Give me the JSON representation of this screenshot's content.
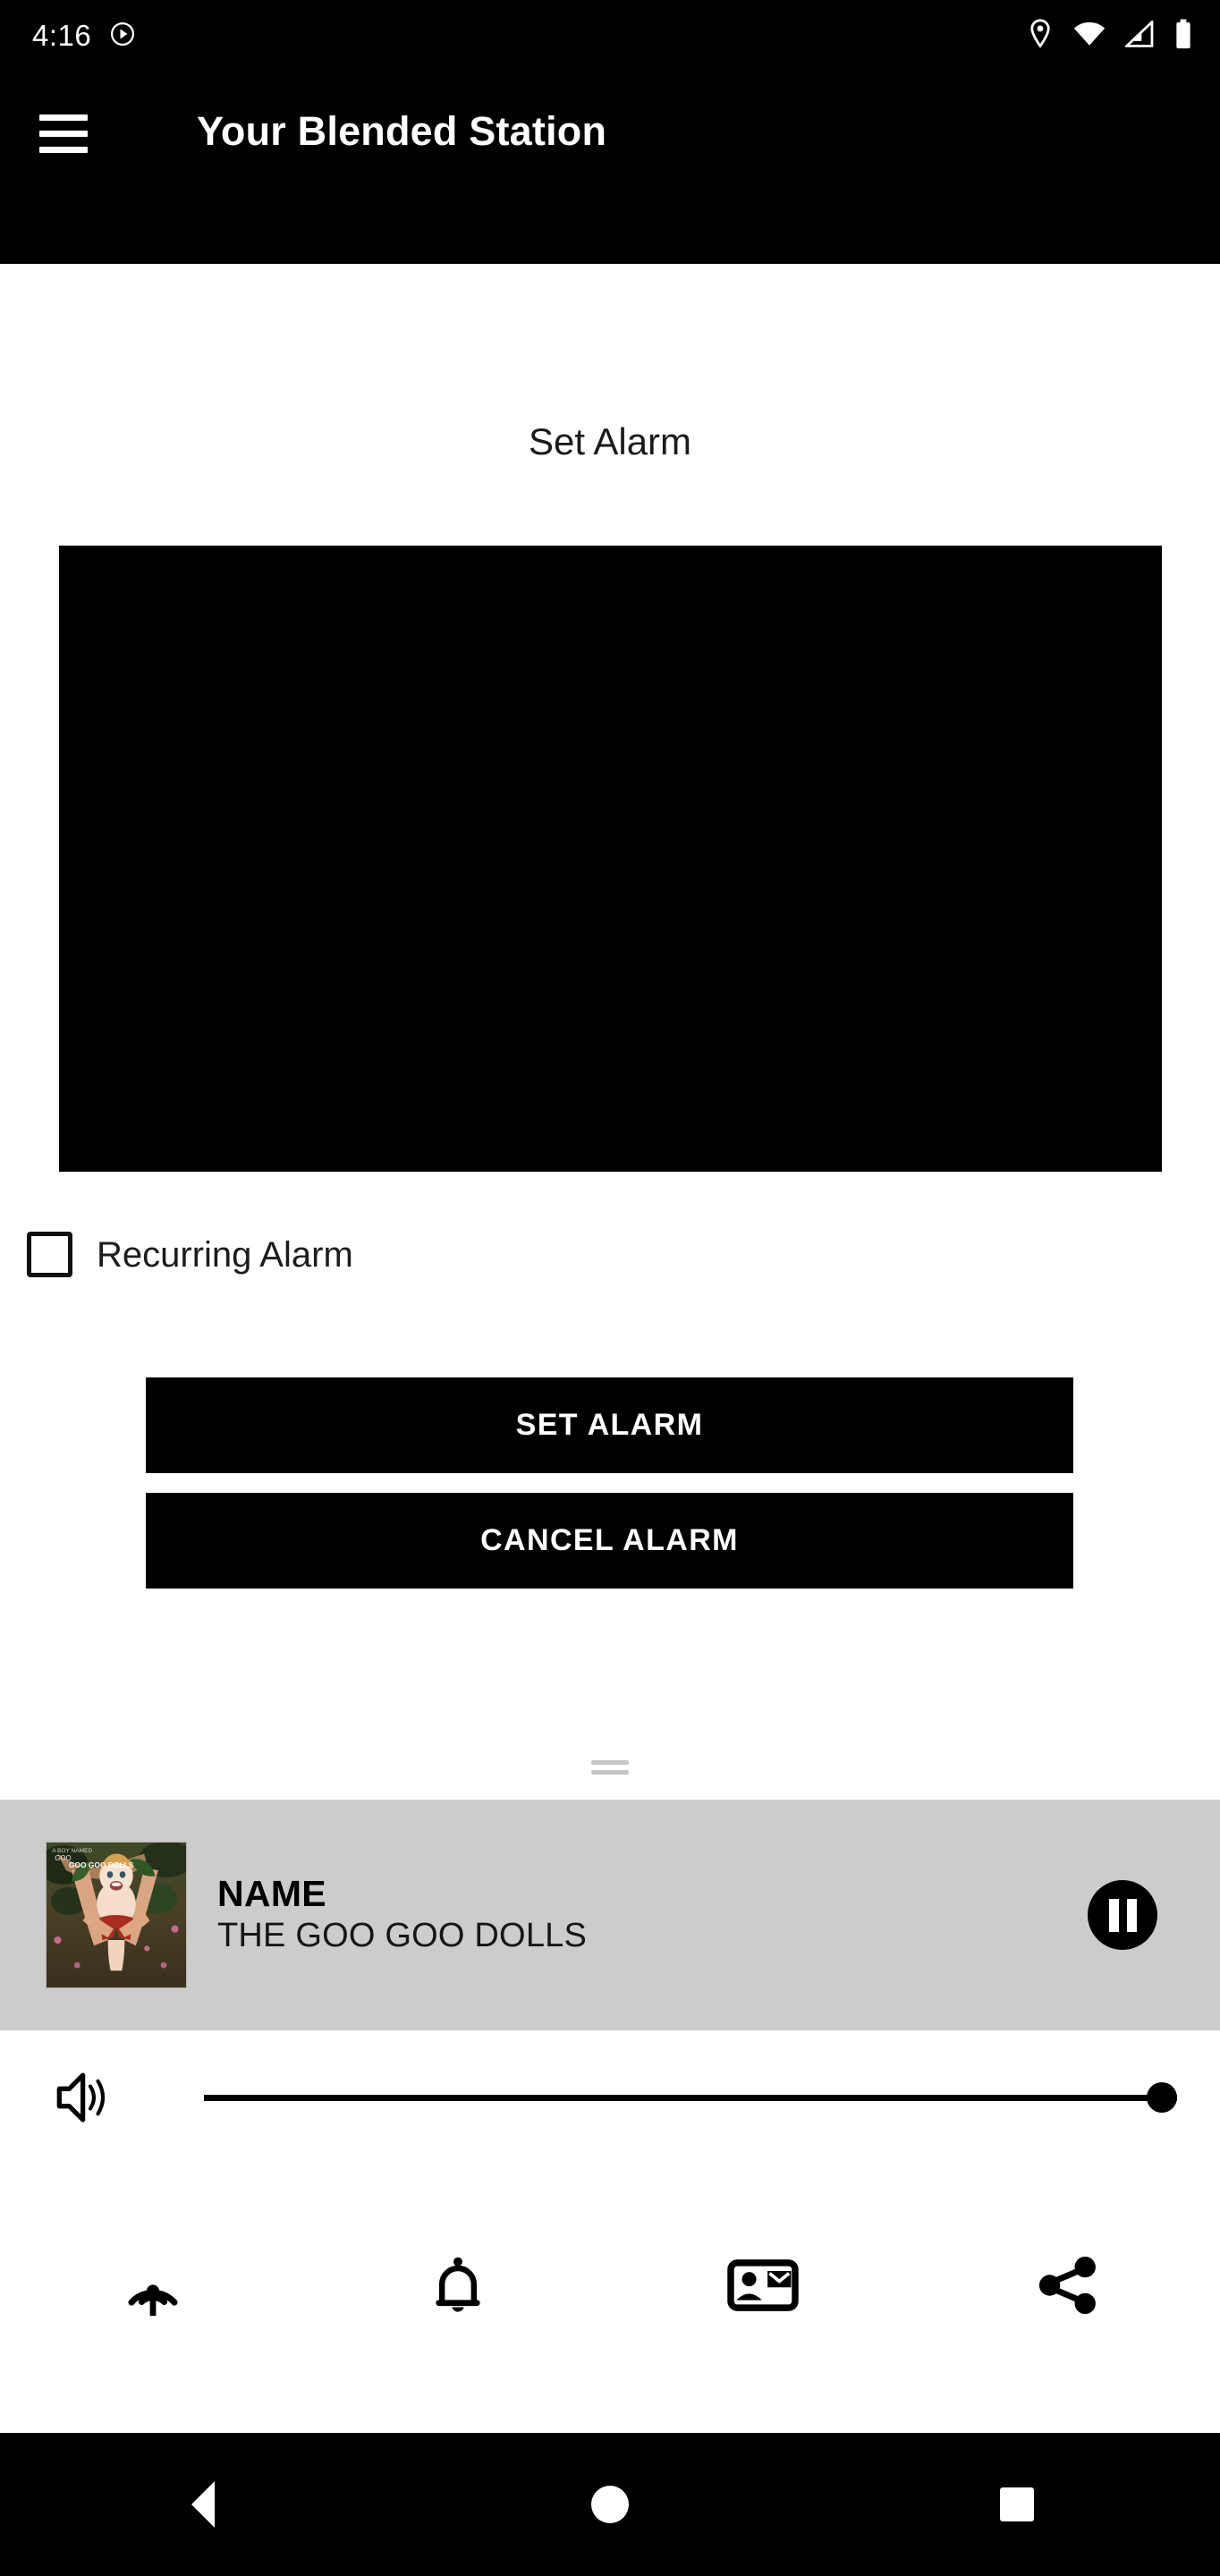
{
  "status_bar": {
    "time": "4:16",
    "left_icons": [
      "play-circle-icon"
    ],
    "right_icons": [
      "location-pin-icon",
      "wifi-icon",
      "cell-signal-icon",
      "battery-icon"
    ]
  },
  "app_bar": {
    "menu_icon": "hamburger-menu-icon",
    "title": "Your Blended Station"
  },
  "main": {
    "section_heading": "Set Alarm",
    "time_picker": {
      "name": "time-picker",
      "background_color": "#000000"
    },
    "recurring": {
      "label": "Recurring Alarm",
      "checked": false
    },
    "buttons": {
      "set_alarm": "SET ALARM",
      "cancel_alarm": "CANCEL ALARM"
    },
    "drag_handle": "drag-handle"
  },
  "now_playing": {
    "background_color": "#cccccc",
    "album_art_alt": "A Boy Named Goo album cover",
    "title": "NAME",
    "artist": "THE GOO GOO DOLLS",
    "transport_icon": "pause-icon",
    "state": "playing"
  },
  "volume": {
    "icon": "volume-up-icon",
    "level": 100
  },
  "tool_row": {
    "items": [
      {
        "name": "broadcast-icon",
        "label": ""
      },
      {
        "name": "bell-icon",
        "label": ""
      },
      {
        "name": "contact-card-icon",
        "label": ""
      },
      {
        "name": "share-icon",
        "label": ""
      }
    ]
  },
  "nav_bar": {
    "back": "back-icon",
    "home": "home-icon",
    "recents": "recents-icon"
  }
}
